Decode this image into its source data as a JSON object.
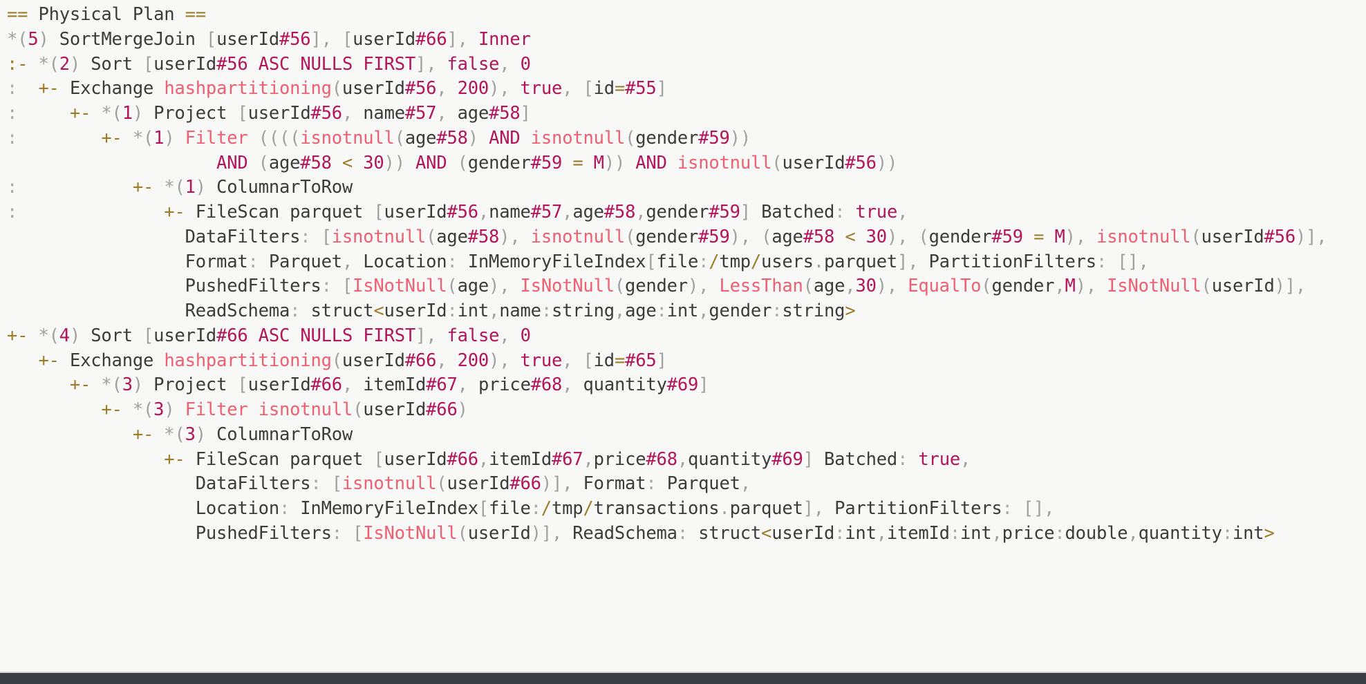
{
  "document": {
    "kind": "spark-physical-plan-text",
    "header": "== Physical Plan ==",
    "background_color": "#f8f8f5",
    "colors": {
      "plain": "#3b3b3b",
      "punctuation": "#a0a0a0",
      "number": "#b3145a",
      "function": "#ef5f72",
      "operator": "#9c7c2a",
      "keyword": "#b3145a",
      "guide": "#a8a8a8",
      "bottom_bar": "#3a3f44"
    }
  },
  "plan": {
    "title": "== Physical Plan ==",
    "line_count": 22,
    "lines": [
      {
        "n": 1,
        "text": "== Physical Plan =="
      },
      {
        "n": 2,
        "text": "*(5) SortMergeJoin [userId#56], [userId#66], Inner"
      },
      {
        "n": 3,
        "text": ":- *(2) Sort [userId#56 ASC NULLS FIRST], false, 0"
      },
      {
        "n": 4,
        "text": ":  +- Exchange hashpartitioning(userId#56, 200), true, [id=#55]"
      },
      {
        "n": 5,
        "text": ":     +- *(1) Project [userId#56, name#57, age#58]"
      },
      {
        "n": 6,
        "text": ":        +- *(1) Filter ((((isnotnull(age#58) AND isnotnull(gender#59))"
      },
      {
        "n": 7,
        "text": "                    AND (age#58 < 30)) AND (gender#59 = M)) AND isnotnull(userId#56))"
      },
      {
        "n": 8,
        "text": ":           +- *(1) ColumnarToRow"
      },
      {
        "n": 9,
        "text": ":              +- FileScan parquet [userId#56,name#57,age#58,gender#59] Batched: true,"
      },
      {
        "n": 10,
        "text": "                 DataFilters: [isnotnull(age#58), isnotnull(gender#59), (age#58 < 30), (gender#59 = M), isnotnull(userId#56)],"
      },
      {
        "n": 11,
        "text": "                 Format: Parquet, Location: InMemoryFileIndex[file:/tmp/users.parquet], PartitionFilters: [],"
      },
      {
        "n": 12,
        "text": "                 PushedFilters: [IsNotNull(age), IsNotNull(gender), LessThan(age,30), EqualTo(gender,M), IsNotNull(userId)],"
      },
      {
        "n": 13,
        "text": "                 ReadSchema: struct<userId:int,name:string,age:int,gender:string>"
      },
      {
        "n": 14,
        "text": "+- *(4) Sort [userId#66 ASC NULLS FIRST], false, 0"
      },
      {
        "n": 15,
        "text": "   +- Exchange hashpartitioning(userId#66, 200), true, [id=#65]"
      },
      {
        "n": 16,
        "text": "      +- *(3) Project [userId#66, itemId#67, price#68, quantity#69]"
      },
      {
        "n": 17,
        "text": "         +- *(3) Filter isnotnull(userId#66)"
      },
      {
        "n": 18,
        "text": "            +- *(3) ColumnarToRow"
      },
      {
        "n": 19,
        "text": "               +- FileScan parquet [userId#66,itemId#67,price#68,quantity#69] Batched: true,"
      },
      {
        "n": 20,
        "text": "                  DataFilters: [isnotnull(userId#66)], Format: Parquet,"
      },
      {
        "n": 21,
        "text": "                  Location: InMemoryFileIndex[file:/tmp/transactions.parquet], PartitionFilters: [],"
      },
      {
        "n": 22,
        "text": "                  PushedFilters: [IsNotNull(userId)], ReadSchema: struct<userId:int,itemId:int,price:double,quantity:int>"
      }
    ],
    "operators": [
      {
        "id": "*(5)",
        "name": "SortMergeJoin",
        "join_type": "Inner",
        "left_keys": "[userId#56]",
        "right_keys": "[userId#66]"
      },
      {
        "id": "*(2)",
        "name": "Sort",
        "order": "[userId#56 ASC NULLS FIRST]",
        "global": "false",
        "sort_order": "0"
      },
      {
        "id": "",
        "name": "Exchange",
        "partitioning": "hashpartitioning(userId#56, 200)",
        "flag": "true",
        "exchange_id": "[id=#55]"
      },
      {
        "id": "*(1)",
        "name": "Project",
        "projection": "[userId#56, name#57, age#58]"
      },
      {
        "id": "*(1)",
        "name": "Filter",
        "condition": "((((isnotnull(age#58) AND isnotnull(gender#59)) AND (age#58 < 30)) AND (gender#59 = M)) AND isnotnull(userId#56))"
      },
      {
        "id": "*(1)",
        "name": "ColumnarToRow"
      },
      {
        "id": "",
        "name": "FileScan parquet",
        "output": "[userId#56,name#57,age#58,gender#59]",
        "batched": "true",
        "format": "Parquet",
        "location": "InMemoryFileIndex[file:/tmp/users.parquet]",
        "read_schema": "struct<userId:int,name:string,age:int,gender:string>"
      },
      {
        "id": "*(4)",
        "name": "Sort",
        "order": "[userId#66 ASC NULLS FIRST]",
        "global": "false",
        "sort_order": "0"
      },
      {
        "id": "",
        "name": "Exchange",
        "partitioning": "hashpartitioning(userId#66, 200)",
        "flag": "true",
        "exchange_id": "[id=#65]"
      },
      {
        "id": "*(3)",
        "name": "Project",
        "projection": "[userId#66, itemId#67, price#68, quantity#69]"
      },
      {
        "id": "*(3)",
        "name": "Filter",
        "condition": "isnotnull(userId#66)"
      },
      {
        "id": "*(3)",
        "name": "ColumnarToRow"
      },
      {
        "id": "",
        "name": "FileScan parquet",
        "output": "[userId#66,itemId#67,price#68,quantity#69]",
        "batched": "true",
        "format": "Parquet",
        "location": "InMemoryFileIndex[file:/tmp/transactions.parquet]",
        "read_schema": "struct<userId:int,itemId:int,price:double,quantity:int>"
      }
    ]
  }
}
